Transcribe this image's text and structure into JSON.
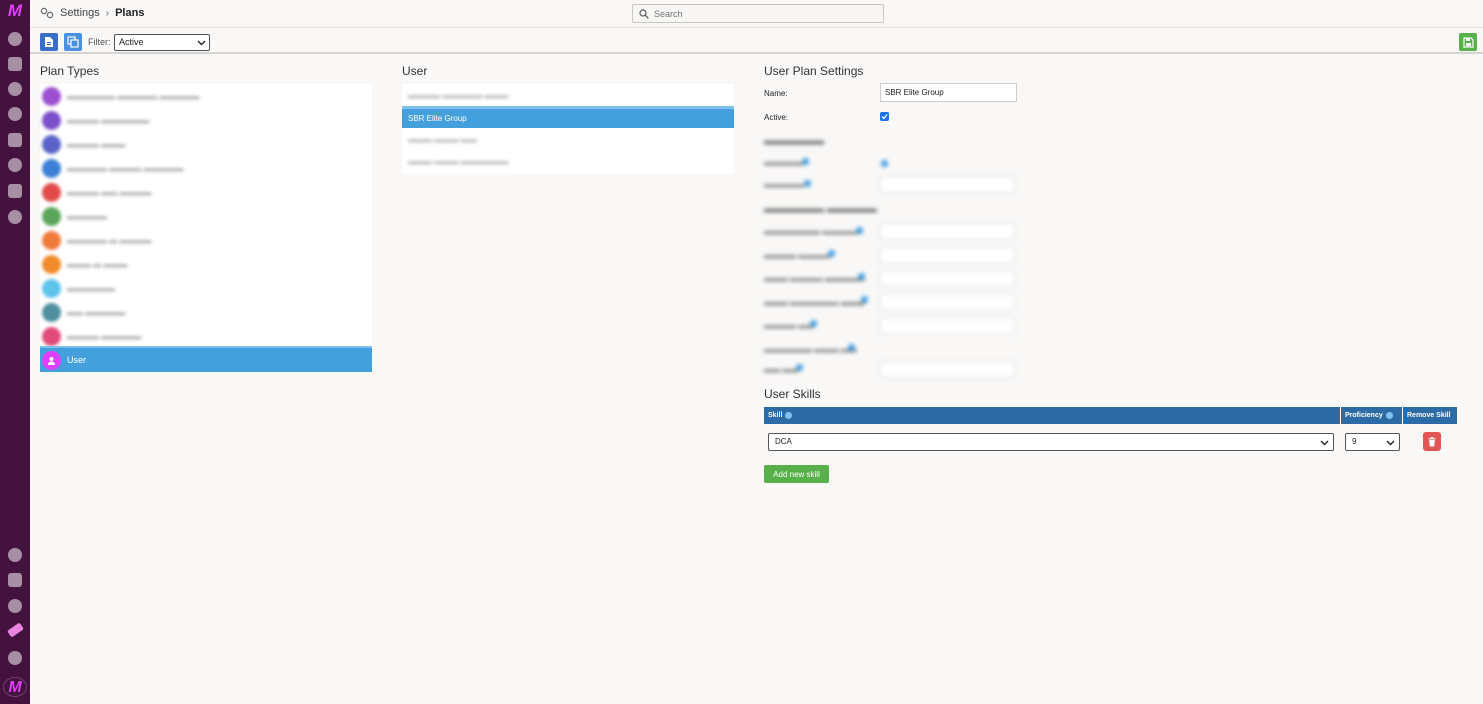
{
  "rail": {
    "logo_text": "M",
    "icons": [
      "dashboard-icon",
      "schedule-icon",
      "settings-icon",
      "users-icon",
      "reports-icon",
      "stats-icon",
      "plans-icon",
      "gear-icon",
      "bottom-icon-1",
      "bottom-icon-2",
      "bottom-icon-3",
      "bottom-icon-4",
      "bottom-icon-5"
    ]
  },
  "breadcrumb": {
    "section": "Settings",
    "separator": "›",
    "current": "Plans"
  },
  "search": {
    "placeholder": "Search"
  },
  "toolbar": {
    "filter_label": "Filter:",
    "filter_value": "Active"
  },
  "plan_types": {
    "title": "Plan Types",
    "blurred_items": [
      {
        "color": "#9c4fcf"
      },
      {
        "color": "#7b4fc7"
      },
      {
        "color": "#5a63c8"
      },
      {
        "color": "#3b7fd6"
      },
      {
        "color": "#e24a4a"
      },
      {
        "color": "#5aa55a"
      },
      {
        "color": "#ef7a3a"
      },
      {
        "color": "#f08a2a"
      },
      {
        "color": "#5fc3ea"
      },
      {
        "color": "#4f8f9f"
      },
      {
        "color": "#e24a7a"
      }
    ],
    "selected_label": "User"
  },
  "user_panel": {
    "title": "User",
    "selected": "SBR Elite Group"
  },
  "settings": {
    "title": "User Plan Settings",
    "name_label": "Name:",
    "name_value": "SBR Elite Group",
    "active_label": "Active:"
  },
  "skills": {
    "title": "User Skills",
    "headers": {
      "skill": "Skill",
      "proficiency": "Proficiency",
      "remove": "Remove Skill"
    },
    "rows": [
      {
        "skill": "DCA",
        "proficiency": "9"
      }
    ],
    "add_label": "Add new skill"
  },
  "colors": {
    "rail": "#43123e",
    "selected": "#43a0dd",
    "table_header": "#2c6ba6",
    "add_button": "#58b04a",
    "remove_button": "#e25555"
  }
}
